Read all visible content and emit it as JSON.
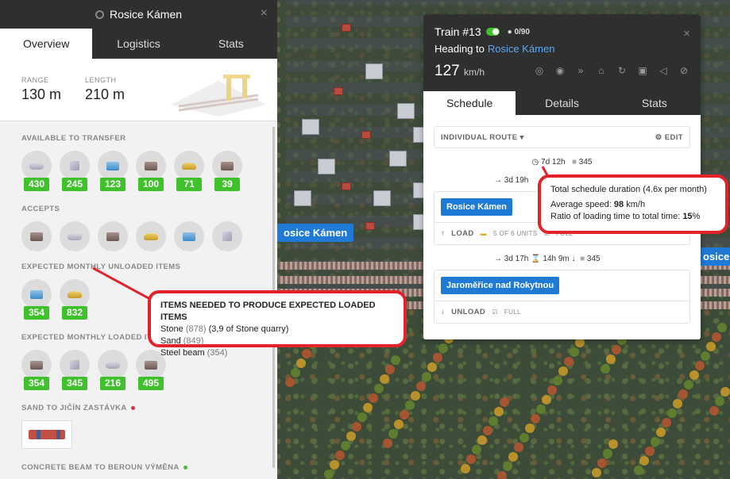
{
  "station": {
    "title": "Rosice Kámen",
    "close": "×",
    "tabs": [
      "Overview",
      "Logistics",
      "Stats"
    ],
    "range_label": "RANGE",
    "range_value": "130 m",
    "length_label": "LENGTH",
    "length_value": "210 m",
    "available_title": "AVAILABLE TO TRANSFER",
    "available": [
      {
        "icon": "stone",
        "value": "430"
      },
      {
        "icon": "cube",
        "value": "245"
      },
      {
        "icon": "blue-crate",
        "value": "123"
      },
      {
        "icon": "brown-crate",
        "value": "100"
      },
      {
        "icon": "sand",
        "value": "71"
      },
      {
        "icon": "brown-crate",
        "value": "39"
      }
    ],
    "accepts_title": "ACCEPTS",
    "accepts": [
      "brown-crate",
      "stone",
      "brown-crate",
      "sand",
      "blue-crate",
      "cube"
    ],
    "unloaded_title": "EXPECTED MONTHLY UNLOADED ITEMS",
    "unloaded": [
      {
        "icon": "blue-crate",
        "value": "354"
      },
      {
        "icon": "sand",
        "value": "832"
      }
    ],
    "loaded_title": "EXPECTED MONTHLY LOADED ITE",
    "loaded": [
      {
        "icon": "brown-crate",
        "value": "354"
      },
      {
        "icon": "cube",
        "value": "345"
      },
      {
        "icon": "stone",
        "value": "216"
      },
      {
        "icon": "brown-crate",
        "value": "495"
      }
    ],
    "route1": "SAND TO JIČÍN ZASTÁVKA",
    "route2": "CONCRETE BEAM TO BEROUN VÝMĚNA"
  },
  "map": {
    "label_left": "osice Kámen",
    "label_right": "osice"
  },
  "train": {
    "title": "Train #13",
    "capacity": "0/90",
    "heading_prefix": "Heading to",
    "heading_dest": "Rosice Kámen",
    "speed": "127",
    "speed_unit": "km/h",
    "tabs": [
      "Schedule",
      "Details",
      "Stats"
    ],
    "route_type": "INDIVIDUAL ROUTE",
    "edit": "EDIT",
    "duration": "7d 12h",
    "cargo_total": "345",
    "leg1": "3d 19h",
    "stop1": "Rosice Kámen",
    "stop1_action": "LOAD",
    "stop1_units": "5 OF 6 UNITS",
    "stop1_full": "FULL",
    "leg2": "3d 17h",
    "leg2_load": "14h 9m",
    "leg2_cargo": "345",
    "stop2": "Jaroměřice nad Rokytnou",
    "stop2_action": "UNLOAD",
    "stop2_full": "FULL"
  },
  "tooltip_items": {
    "title": "ITEMS NEEDED TO PRODUCE EXPECTED LOADED ITEMS",
    "rows": [
      {
        "name": "Stone",
        "qty": "(878)",
        "extra": "(3,9 of Stone quarry)"
      },
      {
        "name": "Sand",
        "qty": "(849)",
        "extra": ""
      },
      {
        "name": "Steel beam",
        "qty": "(354)",
        "extra": ""
      }
    ]
  },
  "tooltip_schedule": {
    "line1": "Total schedule duration (4.6x per month)",
    "speed_label": "Average speed:",
    "speed_value": "98",
    "speed_unit": "km/h",
    "ratio_label": "Ratio of loading time to total time:",
    "ratio_value": "15",
    "ratio_unit": "%"
  },
  "colors": {
    "accent": "#1f7ad6",
    "badge": "#3fc12b",
    "annotation": "#e4222a",
    "header": "#2f2f2f"
  }
}
